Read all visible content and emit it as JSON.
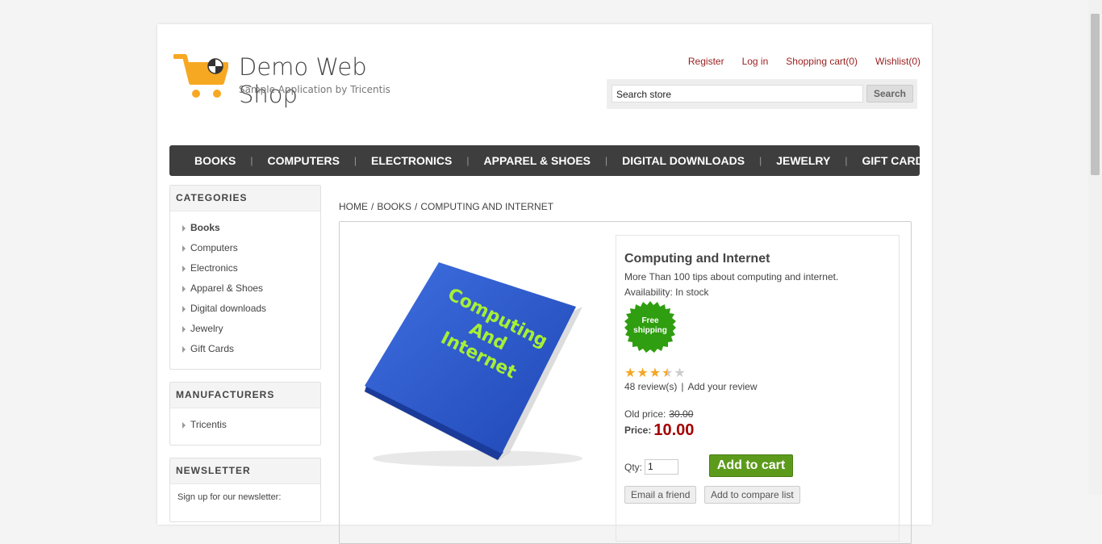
{
  "header": {
    "logo_title": "Demo Web Shop",
    "logo_subtitle": "Sample Application by Tricentis",
    "links": {
      "register": "Register",
      "login": "Log in",
      "cart": "Shopping cart(0)",
      "wishlist": "Wishlist(0)"
    },
    "search": {
      "value": "Search store",
      "button_label": "Search"
    }
  },
  "topmenu": [
    "BOOKS",
    "COMPUTERS",
    "ELECTRONICS",
    "APPAREL & SHOES",
    "DIGITAL DOWNLOADS",
    "JEWELRY",
    "GIFT CARDS"
  ],
  "categories": {
    "title": "CATEGORIES",
    "items": [
      "Books",
      "Computers",
      "Electronics",
      "Apparel & Shoes",
      "Digital downloads",
      "Jewelry",
      "Gift Cards"
    ]
  },
  "manufacturers": {
    "title": "MANUFACTURERS",
    "items": [
      "Tricentis"
    ]
  },
  "newsletter": {
    "title": "NEWSLETTER",
    "text": "Sign up for our newsletter:"
  },
  "breadcrumb": [
    "HOME",
    "BOOKS",
    "COMPUTING AND INTERNET"
  ],
  "product": {
    "name": "Computing and Internet",
    "description": "More Than 100 tips about computing and internet.",
    "availability": "Availability: In stock",
    "badge_line1": "Free",
    "badge_line2": "shipping",
    "image_text_lines": [
      "Computing",
      "And",
      "Internet"
    ],
    "rating": 3.5,
    "reviews_count_label": "48 review(s)",
    "add_review_label": "Add your review",
    "old_price_label": "Old price:",
    "old_price": "30.00",
    "price_label": "Price:",
    "price": "10.00",
    "qty_label": "Qty:",
    "qty_value": "1",
    "add_to_cart_label": "Add to cart",
    "email_friend_label": "Email a friend",
    "compare_label": "Add to compare list"
  },
  "colors": {
    "link": "#991e1e",
    "menu_bg": "#3e3e3e",
    "price": "#a40000",
    "cart_button": "#5c9a1b",
    "logo_orange": "#f7a823",
    "badge_green": "#2f9e10"
  },
  "icons": {
    "logo": "shopping-cart-icon",
    "bullet": "triangle-right-icon",
    "star": "star-icon"
  }
}
